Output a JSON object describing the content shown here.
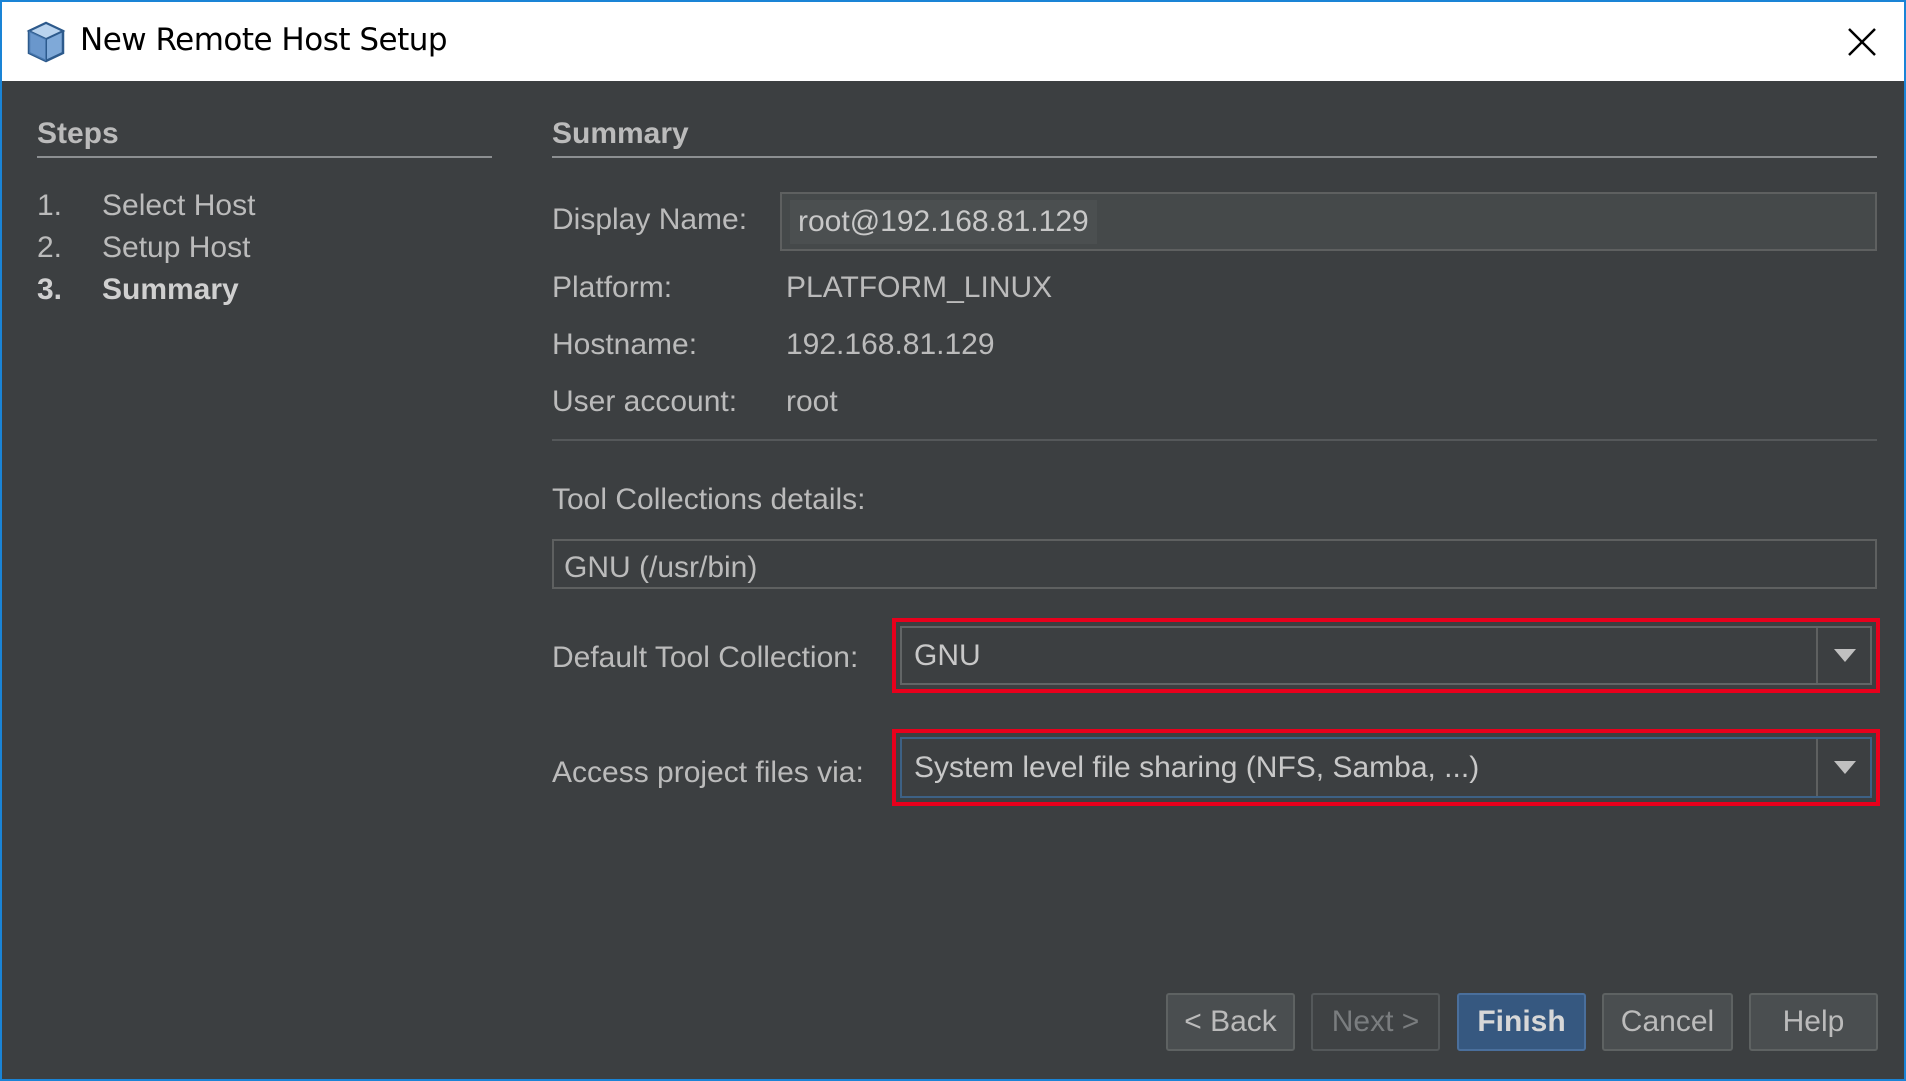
{
  "window": {
    "title": "New Remote Host Setup"
  },
  "steps": {
    "title": "Steps",
    "items": [
      {
        "num": "1.",
        "label": "Select Host",
        "active": false
      },
      {
        "num": "2.",
        "label": "Setup Host",
        "active": false
      },
      {
        "num": "3.",
        "label": "Summary",
        "active": true
      }
    ]
  },
  "summary": {
    "title": "Summary",
    "display_name_label": "Display Name:",
    "display_name_value": "root@192.168.81.129",
    "platform_label": "Platform:",
    "platform_value": "PLATFORM_LINUX",
    "hostname_label": "Hostname:",
    "hostname_value": "192.168.81.129",
    "user_label": "User account:",
    "user_value": "root",
    "tool_collections_label": "Tool Collections details:",
    "tool_collections": [
      "GNU (/usr/bin)"
    ],
    "default_tool_label": "Default Tool Collection:",
    "default_tool_value": "GNU",
    "access_label": "Access project files via:",
    "access_value": "System level file sharing (NFS, Samba, ...)"
  },
  "buttons": {
    "back": "< Back",
    "next": "Next >",
    "finish": "Finish",
    "cancel": "Cancel",
    "help": "Help"
  },
  "colors": {
    "background": "#3c3f41",
    "highlight": "#e8001c",
    "primary_button": "#365880"
  }
}
